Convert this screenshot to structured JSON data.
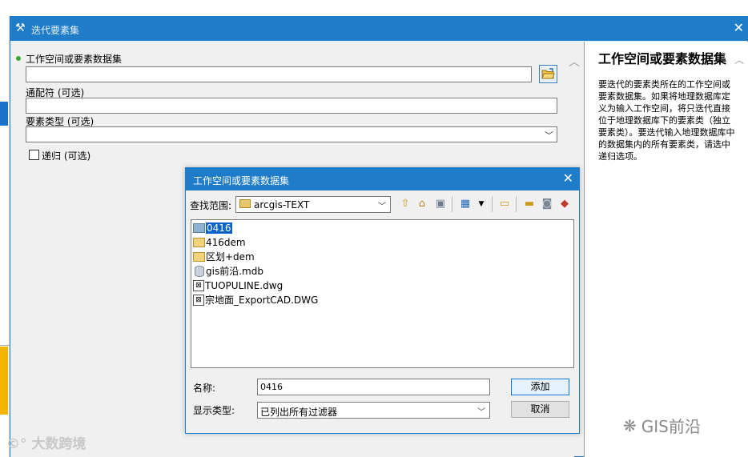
{
  "main_window": {
    "title": "迭代要素集",
    "fields": {
      "workspace_label": "工作空间或要素数据集",
      "wildcard_label": "通配符 (可选)",
      "feature_type_label": "要素类型 (可选)",
      "recursive_label": "递归 (可选)"
    }
  },
  "help": {
    "title": "工作空间或要素数据集",
    "body": "要迭代的要素类所在的工作空间或要素数据集。如果将地理数据库定义为输入工作空间，将只迭代直接位于地理数据库下的要素类（独立要素类）。要迭代输入地理数据库中的数据集内的所有要素类，请选中递归选项。"
  },
  "dialog": {
    "title": "工作空间或要素数据集",
    "look_in_label": "查找范围:",
    "look_in_value": "arcgis-TEXT",
    "files": [
      {
        "name": "0416",
        "type": "folder",
        "selected": true
      },
      {
        "name": "416dem",
        "type": "folder",
        "selected": false
      },
      {
        "name": "区划+dem",
        "type": "folder",
        "selected": false
      },
      {
        "name": "gis前沿.mdb",
        "type": "database",
        "selected": false
      },
      {
        "name": "TUOPULINE.dwg",
        "type": "cad",
        "selected": false
      },
      {
        "name": "宗地面_ExportCAD.DWG",
        "type": "cad",
        "selected": false
      }
    ],
    "name_label": "名称:",
    "name_value": "0416",
    "show_type_label": "显示类型:",
    "show_type_value": "已列出所有过滤器",
    "add_button": "添加",
    "cancel_button": "取消"
  },
  "watermarks": {
    "left": "大数跨境",
    "right": "GIS前沿"
  }
}
